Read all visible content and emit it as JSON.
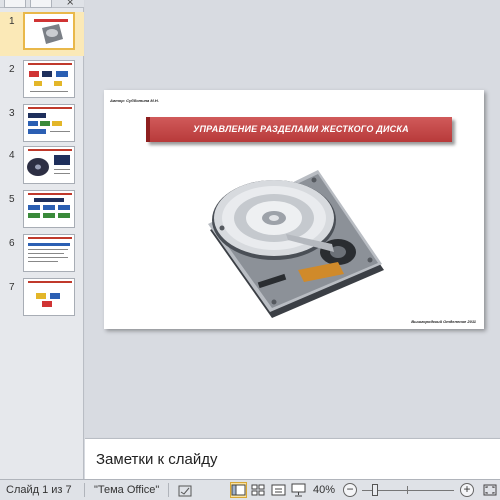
{
  "thumbnails": [
    {
      "number": "1"
    },
    {
      "number": "2"
    },
    {
      "number": "3"
    },
    {
      "number": "4"
    },
    {
      "number": "5"
    },
    {
      "number": "6"
    },
    {
      "number": "7"
    }
  ],
  "pane": {
    "close_glyph": "×"
  },
  "slide": {
    "author": "Автор: Субботина М.Н.",
    "title": "УПРАВЛЕНИЕ РАЗДЕЛАМИ ЖЕСТКОГО ДИСКА",
    "credit": "Вышгородский Отделение 2011",
    "title_color": "#c04545"
  },
  "notes": {
    "placeholder": "Заметки к слайду"
  },
  "status": {
    "slide_counter": "Слайд 1 из 7",
    "theme": "\"Тема Office\"",
    "zoom": "40%",
    "zoom_out": "−",
    "zoom_in": "+"
  },
  "colors": {
    "accent": "#e9b84a",
    "title_band": "#c04545"
  }
}
